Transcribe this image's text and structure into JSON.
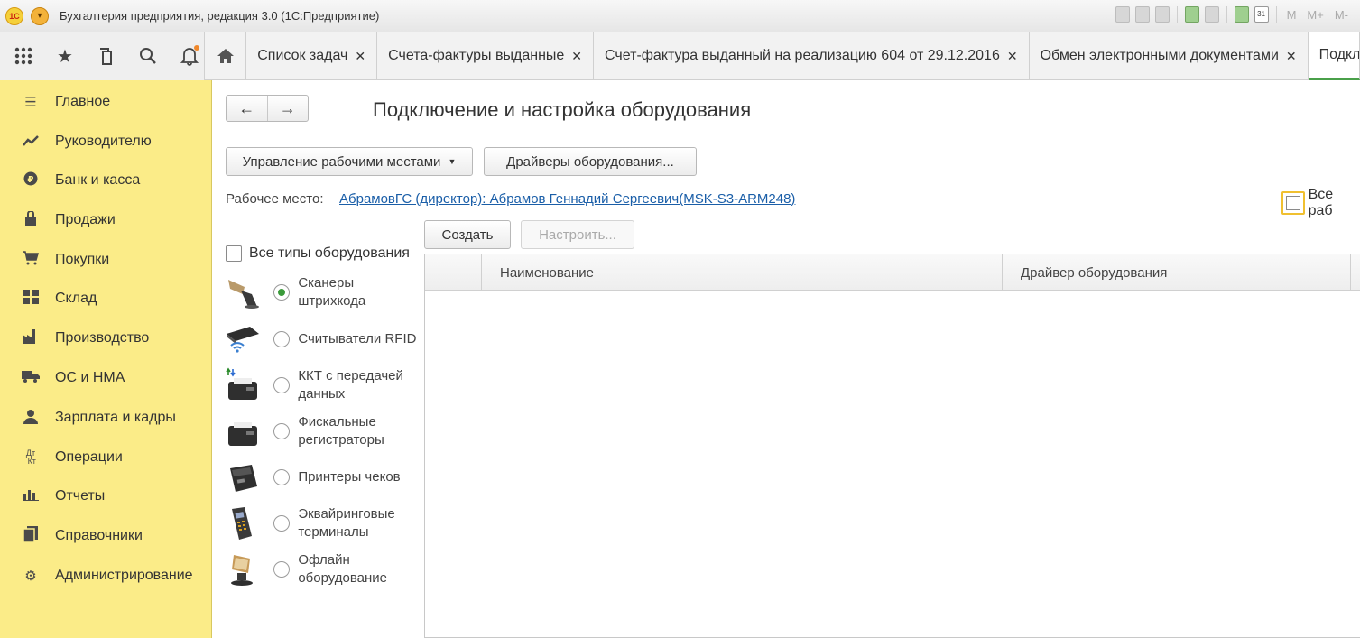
{
  "window": {
    "title": "Бухгалтерия предприятия, редакция 3.0  (1С:Предприятие)",
    "tool_letters": [
      "M",
      "M+",
      "M-"
    ]
  },
  "tabs": [
    {
      "label": "Список задач"
    },
    {
      "label": "Счета-фактуры выданные"
    },
    {
      "label": "Счет-фактура выданный на реализацию 604 от 29.12.2016"
    },
    {
      "label": "Обмен электронными документами"
    },
    {
      "label": "Подкл"
    }
  ],
  "sidebar": {
    "items": [
      {
        "label": "Главное",
        "icon": "menu-icon"
      },
      {
        "label": "Руководителю",
        "icon": "trend-icon"
      },
      {
        "label": "Банк и касса",
        "icon": "coin-icon"
      },
      {
        "label": "Продажи",
        "icon": "bag-icon"
      },
      {
        "label": "Покупки",
        "icon": "cart-icon"
      },
      {
        "label": "Склад",
        "icon": "warehouse-icon"
      },
      {
        "label": "Производство",
        "icon": "factory-icon"
      },
      {
        "label": "ОС и НМА",
        "icon": "truck-icon"
      },
      {
        "label": "Зарплата и кадры",
        "icon": "person-icon"
      },
      {
        "label": "Операции",
        "icon": "dt-kt-icon"
      },
      {
        "label": "Отчеты",
        "icon": "chart-icon"
      },
      {
        "label": "Справочники",
        "icon": "books-icon"
      },
      {
        "label": "Администрирование",
        "icon": "gear-icon"
      }
    ]
  },
  "main": {
    "title": "Подключение и настройка оборудования",
    "manage_workplaces": "Управление рабочими местами",
    "drivers": "Драйверы оборудования...",
    "workplace_label": "Рабочее место:",
    "workplace_value": "АбрамовГС (директор): Абрамов Геннадий Сергеевич(MSK-S3-ARM248)",
    "all_workplaces": "Все раб",
    "all_types": "Все типы оборудования",
    "create": "Создать",
    "configure": "Настроить...",
    "columns": [
      "Наименование",
      "Драйвер оборудования"
    ],
    "equipment": [
      {
        "label": "Сканеры штрихкода",
        "selected": true
      },
      {
        "label": "Считыватели RFID",
        "selected": false
      },
      {
        "label": "ККТ с передачей данных",
        "selected": false
      },
      {
        "label": "Фискальные регистраторы",
        "selected": false
      },
      {
        "label": "Принтеры чеков",
        "selected": false
      },
      {
        "label": "Эквайринговые терминалы",
        "selected": false
      },
      {
        "label": "Офлайн оборудование",
        "selected": false
      }
    ]
  }
}
